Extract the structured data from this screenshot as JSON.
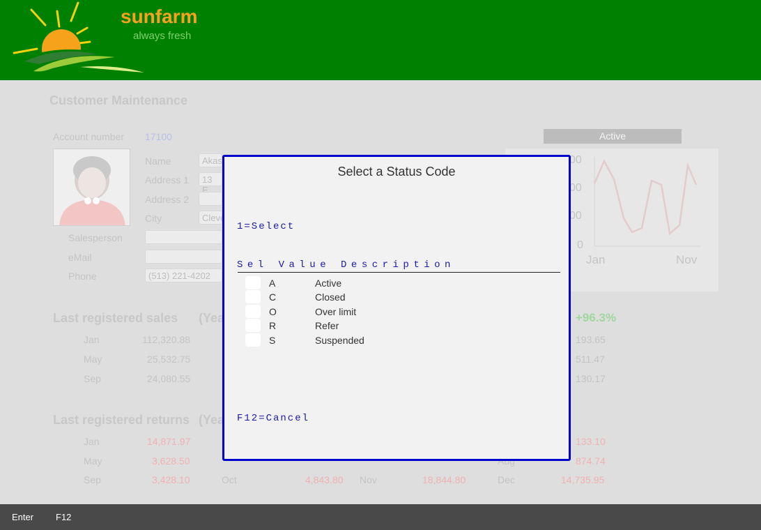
{
  "brand": {
    "name": "sunfarm",
    "tagline": "always fresh"
  },
  "page": {
    "title": "Customer Maintenance",
    "account_label": "Account number",
    "account_number": "17100",
    "fields": {
      "name_label": "Name",
      "name_value": "Akas",
      "address1_label": "Address 1",
      "address1_value": "13 E",
      "address2_label": "Address 2",
      "city_label": "City",
      "city_value": "Cleve",
      "salesperson_label": "Salesperson",
      "email_label": "eMail",
      "phone_label": "Phone",
      "phone_value": "(513) 221-4202"
    },
    "status_bar": "Active",
    "chart": {
      "y_ticks": [
        "00",
        "00",
        "00",
        "0"
      ],
      "x_ticks": [
        "Jan",
        "Nov"
      ]
    },
    "sales": {
      "title": "Last registered sales",
      "year_label": "(Yea",
      "pct": "+96.3%",
      "rows": [
        {
          "month": "Jan",
          "value": "112,320.88",
          "right": "193.65"
        },
        {
          "month": "May",
          "value": "25,532.75",
          "right": "511.47"
        },
        {
          "month": "Sep",
          "value": "24,080.55",
          "right": "130.17"
        }
      ]
    },
    "returns": {
      "title": "Last registered returns",
      "year_label": "(Yea",
      "rows": [
        {
          "m1": "Jan",
          "v1": "14,871.97",
          "m2": "",
          "v2": "",
          "m3": "",
          "v3": "",
          "m4": "",
          "v4": "133.10"
        },
        {
          "m1": "May",
          "v1": "3,628.50",
          "m2": "",
          "v2": "",
          "m3": "",
          "v3": "",
          "m4": "Aug",
          "v4": "874.74"
        },
        {
          "m1": "Sep",
          "v1": "3,428.10",
          "m2": "Oct",
          "v2": "4,843.80",
          "m3": "Nov",
          "v3": "18,844.80",
          "m4": "Dec",
          "v4": "14,735.95"
        }
      ]
    }
  },
  "modal": {
    "title": "Select a Status Code",
    "select_hint": "1=Select",
    "col_header": "Sel Value Description",
    "items": [
      {
        "code": "A",
        "description": "Active"
      },
      {
        "code": "C",
        "description": "Closed"
      },
      {
        "code": "O",
        "description": "Over limit"
      },
      {
        "code": "R",
        "description": "Refer"
      },
      {
        "code": "S",
        "description": "Suspended"
      }
    ],
    "cancel_hint": "F12=Cancel"
  },
  "footer": {
    "keys": [
      "Enter",
      "F12"
    ]
  },
  "colors": {
    "header_green": "#008000",
    "brand_orange": "#f7a21b",
    "modal_border": "#0000cc",
    "hint_blue": "#1a1aaa",
    "footer_bg": "#494949"
  }
}
